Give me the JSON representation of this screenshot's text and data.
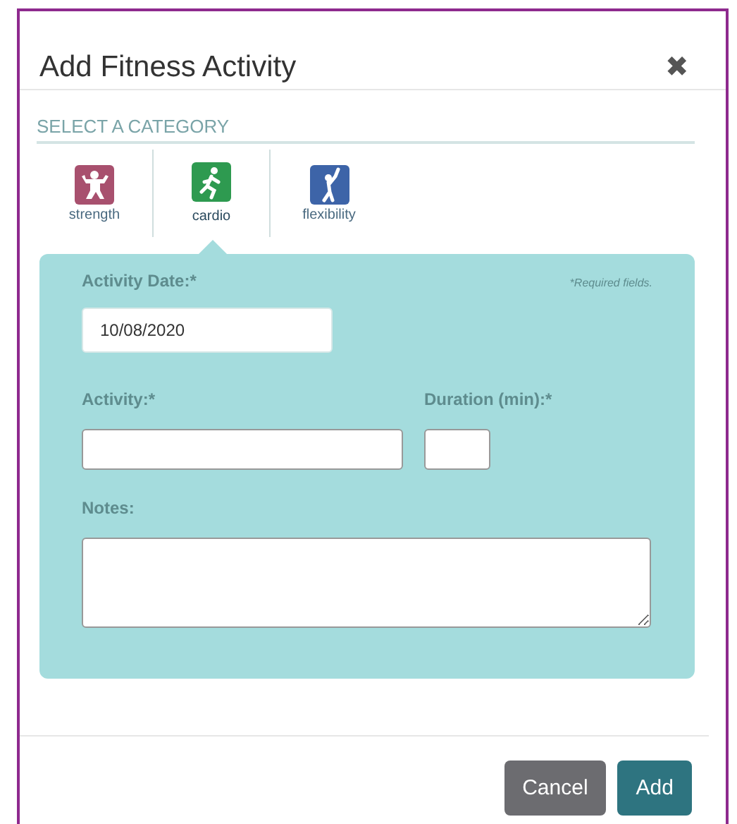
{
  "dialog": {
    "title": "Add Fitness Activity",
    "close": "✖"
  },
  "category_label": "SELECT A CATEGORY",
  "categories": [
    {
      "kind": "strength",
      "label": "strength",
      "color": "#a8506e",
      "selected": false
    },
    {
      "kind": "cardio",
      "label": "cardio",
      "color": "#2e9a50",
      "selected": true
    },
    {
      "kind": "flexibility",
      "label": "flexibility",
      "color": "#3d64a8",
      "selected": false
    }
  ],
  "form": {
    "date_label": "Activity Date:*",
    "required_note": "*Required fields.",
    "date_value": "10/08/2020",
    "activity_label": "Activity:*",
    "duration_label": "Duration (min):*",
    "notes_label": "Notes:"
  },
  "buttons": [
    {
      "kind": "secondary",
      "label": "Cancel"
    },
    {
      "kind": "primary",
      "label": "Add"
    }
  ]
}
